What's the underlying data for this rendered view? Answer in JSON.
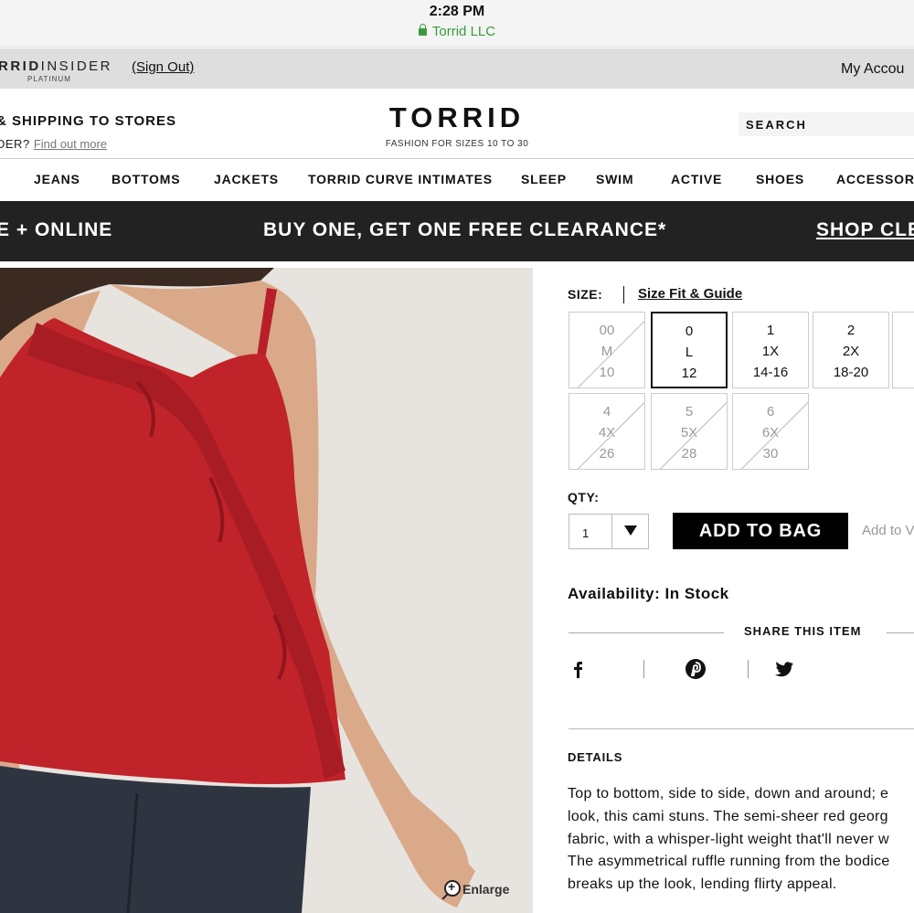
{
  "status_bar": {
    "time": "2:28 PM",
    "site": "Torrid LLC"
  },
  "insider_bar": {
    "logo_bold": "RRID",
    "logo_light": "INSIDER",
    "tier": "PLATINUM",
    "sign_out": "(Sign Out)",
    "account": "My Accou"
  },
  "header": {
    "promo_line1": "& SHIPPING TO STORES",
    "promo_line2": "DER?",
    "promo_link": "Find out more",
    "brand": "TORRID",
    "tagline": "FASHION FOR SIZES 10 TO 30",
    "search_placeholder": "SEARCH"
  },
  "nav": {
    "items": [
      "JEANS",
      "BOTTOMS",
      "JACKETS",
      "TORRID CURVE INTIMATES",
      "SLEEP",
      "SWIM",
      "ACTIVE",
      "SHOES",
      "ACCESSORI"
    ]
  },
  "banner": {
    "left": "E + ONLINE",
    "center": "BUY ONE, GET ONE FREE CLEARANCE*",
    "right": "SHOP CLE"
  },
  "product_image": {
    "enlarge": "Enlarge"
  },
  "size": {
    "label": "SIZE:",
    "guide": "Size Fit & Guide",
    "options": [
      {
        "a": "00",
        "b": "M",
        "c": "10",
        "available": false,
        "selected": false
      },
      {
        "a": "0",
        "b": "L",
        "c": "12",
        "available": true,
        "selected": true
      },
      {
        "a": "1",
        "b": "1X",
        "c": "14-16",
        "available": true,
        "selected": false
      },
      {
        "a": "2",
        "b": "2X",
        "c": "18-20",
        "available": true,
        "selected": false
      },
      {
        "a": "4",
        "b": "4X",
        "c": "26",
        "available": false,
        "selected": false
      },
      {
        "a": "5",
        "b": "5X",
        "c": "28",
        "available": false,
        "selected": false
      },
      {
        "a": "6",
        "b": "6X",
        "c": "30",
        "available": false,
        "selected": false
      }
    ]
  },
  "qty": {
    "label": "QTY:",
    "value": "1"
  },
  "actions": {
    "add_to_bag": "ADD TO BAG",
    "wishlist": "Add to V"
  },
  "availability": "Availability: In Stock",
  "share": {
    "title": "SHARE THIS ITEM",
    "icons": [
      "facebook-icon",
      "pinterest-icon",
      "twitter-icon"
    ]
  },
  "details": {
    "title": "DETAILS",
    "lines": [
      "Top to bottom, side to side, down and around; e",
      "look, this cami stuns. The semi-sheer red georg",
      "fabric, with a whisper-light weight that'll never w",
      "The asymmetrical ruffle running from the bodice",
      "breaks up the look, lending flirty appeal."
    ]
  },
  "colors": {
    "banner_bg": "#222222",
    "button_bg": "#000000",
    "secure_green": "#3a9a3a",
    "top_red": "#c0232a"
  }
}
